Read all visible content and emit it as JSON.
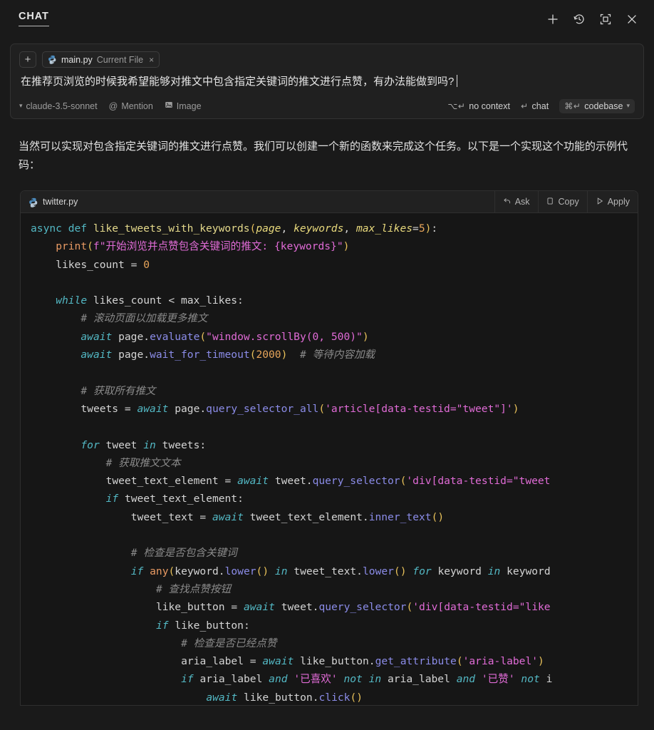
{
  "header": {
    "title": "CHAT",
    "icons": [
      {
        "name": "new-chat-icon",
        "glyph": "plus"
      },
      {
        "name": "history-icon",
        "glyph": "history"
      },
      {
        "name": "maximize-icon",
        "glyph": "maximize"
      },
      {
        "name": "close-icon",
        "glyph": "close"
      }
    ]
  },
  "input": {
    "add_context_label": "+",
    "chip": {
      "icon": "python-icon",
      "filename": "main.py",
      "subtitle": "Current File",
      "close": "×"
    },
    "prompt_value": "在推荐页浏览的时候我希望能够对推文中包含指定关键词的推文进行点赞，有办法能做到吗?",
    "toolbar": {
      "model": "claude-3.5-sonnet",
      "mention": "Mention",
      "mention_prefix": "@",
      "image": "Image",
      "no_context": "no context",
      "no_context_kbd": "⌥↵",
      "chat": "chat",
      "chat_kbd": "↵",
      "codebase": "codebase",
      "codebase_kbd": "⌘↵"
    }
  },
  "assistant": {
    "message": "当然可以实现对包含指定关键词的推文进行点赞。我们可以创建一个新的函数来完成这个任务。以下是一个实现这个功能的示例代码："
  },
  "code_block": {
    "filename": "twitter.py",
    "file_icon": "python-icon",
    "actions": [
      {
        "name": "ask-button",
        "label": "Ask",
        "icon": "reply-arrow-icon"
      },
      {
        "name": "copy-button",
        "label": "Copy",
        "icon": "copy-icon"
      },
      {
        "name": "apply-button",
        "label": "Apply",
        "icon": "play-icon"
      }
    ],
    "language": "python",
    "lines": [
      "async def like_tweets_with_keywords(page, keywords, max_likes=5):",
      "    print(f\"开始浏览并点赞包含关键词的推文: {keywords}\")",
      "    likes_count = 0",
      "",
      "    while likes_count < max_likes:",
      "        # 滚动页面以加载更多推文",
      "        await page.evaluate(\"window.scrollBy(0, 500)\")",
      "        await page.wait_for_timeout(2000)  # 等待内容加载",
      "",
      "        # 获取所有推文",
      "        tweets = await page.query_selector_all('article[data-testid=\"tweet\"]')",
      "",
      "        for tweet in tweets:",
      "            # 获取推文文本",
      "            tweet_text_element = await tweet.query_selector('div[data-testid=\"tweet",
      "            if tweet_text_element:",
      "                tweet_text = await tweet_text_element.inner_text()",
      "",
      "                # 检查是否包含关键词",
      "                if any(keyword.lower() in tweet_text.lower() for keyword in keyword",
      "                    # 查找点赞按钮",
      "                    like_button = await tweet.query_selector('div[data-testid=\"like",
      "                    if like_button:",
      "                        # 检查是否已经点赞",
      "                        aria_label = await like_button.get_attribute('aria-label')",
      "                        if aria_label and '已喜欢' not in aria_label and '已赞' not i",
      "                            await like_button.click()"
    ]
  },
  "colors": {
    "background": "#1a1a1a",
    "code_background": "#161616",
    "keyword": "#53b8c4",
    "function": "#e4d98b",
    "string": "#e06bd6",
    "comment": "#8a8a8a",
    "number": "#e8a55a",
    "method": "#8b8ce8",
    "builtin": "#e89a63",
    "punctuation": "#e8c15a"
  }
}
